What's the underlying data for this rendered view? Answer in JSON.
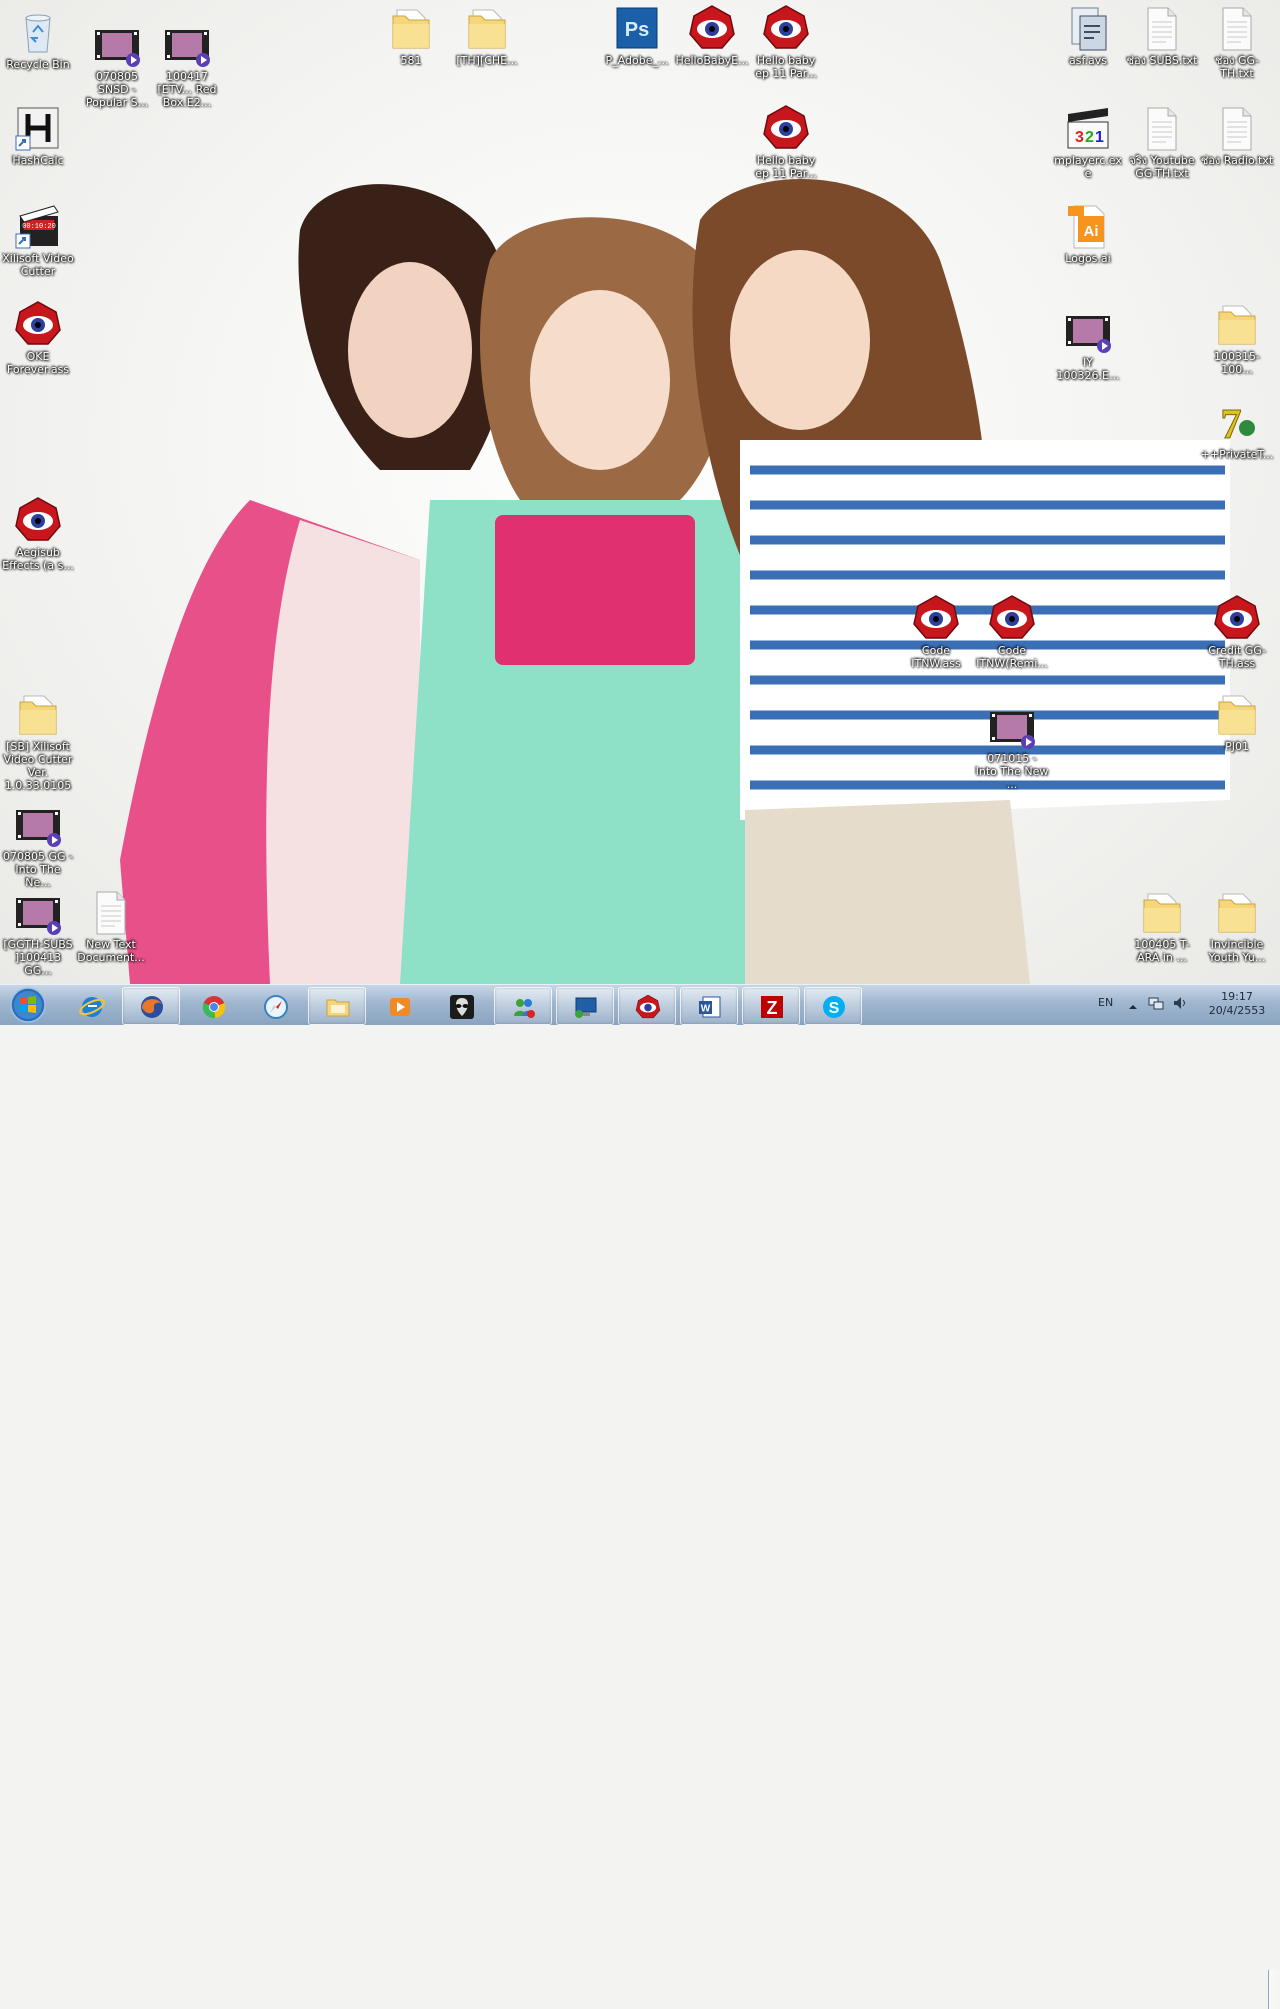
{
  "desktop": {
    "icons": [
      {
        "key": "recycle-bin",
        "label": "Recycle Bin",
        "icon": "recycle-bin-icon"
      },
      {
        "key": "video-070805-snsd",
        "label": "070805 SNSD - Popular S...",
        "icon": "video-file-icon"
      },
      {
        "key": "video-100417",
        "label": "100417 [ETV... Red Box.E2...",
        "icon": "video-file-icon"
      },
      {
        "key": "folder-581",
        "label": "581",
        "icon": "folder-icon"
      },
      {
        "key": "folder-th-che",
        "label": "[TH][CHE...",
        "icon": "folder-icon"
      },
      {
        "key": "psd-adobe",
        "label": "P_Adobe_...",
        "icon": "photoshop-icon"
      },
      {
        "key": "aegisub-hellobaby",
        "label": "HelloBabyE...",
        "icon": "aegisub-icon"
      },
      {
        "key": "aegisub-hellobaby-ep11-a",
        "label": "Hello baby ep 11 Par...",
        "icon": "aegisub-icon"
      },
      {
        "key": "aegisub-hellobaby-ep11-b",
        "label": "Hello baby ep 11 Par...",
        "icon": "aegisub-icon"
      },
      {
        "key": "asf-avs",
        "label": "asf.avs",
        "icon": "avs-script-icon"
      },
      {
        "key": "subs-txt",
        "label": "ช่อง SUBS.txt",
        "icon": "text-file-icon"
      },
      {
        "key": "gg-th-txt",
        "label": "ช่อง GG-TH.txt",
        "icon": "text-file-icon"
      },
      {
        "key": "hashcalc",
        "label": "HashCalc",
        "icon": "hashcalc-icon"
      },
      {
        "key": "mplayerc",
        "label": "mplayerc.exe",
        "icon": "media-player-classic-icon"
      },
      {
        "key": "youtube-gg-th",
        "label": "จริง Youtube GG-TH.txt",
        "icon": "text-file-icon"
      },
      {
        "key": "radio-txt",
        "label": "ช่อง Radio.txt",
        "icon": "text-file-icon"
      },
      {
        "key": "xilisoft-cutter",
        "label": "Xilisoft Video Cutter",
        "icon": "xilisoft-icon"
      },
      {
        "key": "logos-ai",
        "label": "Logos.ai",
        "icon": "illustrator-icon"
      },
      {
        "key": "oke-forever",
        "label": "OKE Forever.ass",
        "icon": "aegisub-icon"
      },
      {
        "key": "iy-100326",
        "label": "IY 100326.E...",
        "icon": "video-file-icon"
      },
      {
        "key": "folder-100315",
        "label": "100315-100...",
        "icon": "folder-icon"
      },
      {
        "key": "private-tracker",
        "label": "++PrivateT...",
        "icon": "seven-zip-icon"
      },
      {
        "key": "aegisub-effects",
        "label": "Aegisub Effects (a s...",
        "icon": "aegisub-icon"
      },
      {
        "key": "code-itnw",
        "label": "Code ITNW.ass",
        "icon": "aegisub-icon"
      },
      {
        "key": "code-itnw-remix",
        "label": "Code ITNW(Remi...",
        "icon": "aegisub-icon"
      },
      {
        "key": "credit-gg-th",
        "label": "Credit GG-TH.ass",
        "icon": "aegisub-icon"
      },
      {
        "key": "folder-sb-xilisoft",
        "label": "[SB] Xilisoft Video Cutter Ver. 1.0.33.0105",
        "icon": "folder-icon"
      },
      {
        "key": "video-071015",
        "label": "071015 - Into The New ...",
        "icon": "video-file-icon"
      },
      {
        "key": "folder-pj01",
        "label": "PJ01",
        "icon": "folder-icon"
      },
      {
        "key": "video-070805-gg",
        "label": "070805 GG - Into The Ne...",
        "icon": "video-file-icon"
      },
      {
        "key": "video-ggth-subs",
        "label": "[GGTH-SUBS ]100413 GG...",
        "icon": "video-file-icon"
      },
      {
        "key": "new-text-doc",
        "label": "New Text Document...",
        "icon": "text-file-icon"
      },
      {
        "key": "folder-100405",
        "label": "100405 T-ARA in ...",
        "icon": "folder-icon"
      },
      {
        "key": "folder-invincible",
        "label": "Invincible Youth Yu...",
        "icon": "folder-icon"
      }
    ]
  },
  "taskbar": {
    "start_label": "Start",
    "buttons": [
      {
        "key": "ie",
        "icon": "internet-explorer-icon",
        "open": false
      },
      {
        "key": "firefox",
        "icon": "firefox-icon",
        "open": true
      },
      {
        "key": "chrome",
        "icon": "chrome-icon",
        "open": false
      },
      {
        "key": "safari",
        "icon": "safari-icon",
        "open": false
      },
      {
        "key": "explorer",
        "icon": "folder-icon",
        "open": true
      },
      {
        "key": "media",
        "icon": "media-player-icon",
        "open": false
      },
      {
        "key": "alien",
        "icon": "alien-icon",
        "open": false
      },
      {
        "key": "messenger",
        "icon": "messenger-icon",
        "open": true
      },
      {
        "key": "remote",
        "icon": "remote-desktop-icon",
        "open": true
      },
      {
        "key": "aegisub",
        "icon": "aegisub-icon",
        "open": true
      },
      {
        "key": "word",
        "icon": "word-icon",
        "open": true
      },
      {
        "key": "filezilla",
        "icon": "filezilla-icon",
        "open": true
      },
      {
        "key": "skype",
        "icon": "skype-icon",
        "open": true
      }
    ],
    "tray": {
      "language": "EN",
      "time": "19:17",
      "date": "20/4/2553"
    }
  },
  "colors": {
    "taskbar": "#9fb6cf",
    "wallpaper": "#f3f3f1",
    "icon_label": "#ffffff"
  }
}
